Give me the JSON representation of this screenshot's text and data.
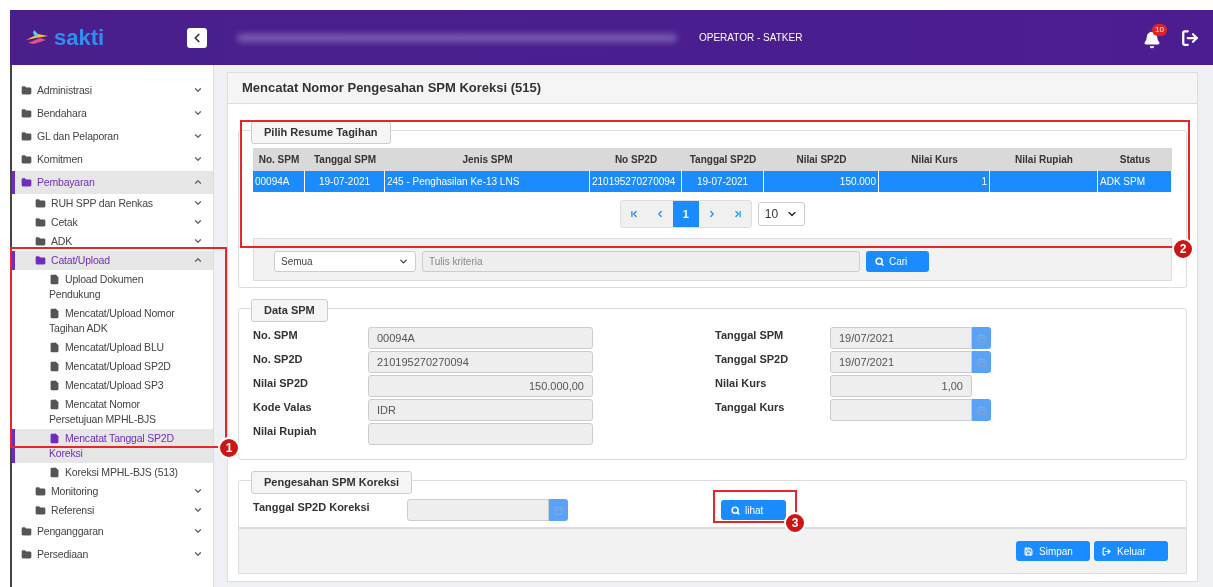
{
  "header": {
    "logo_text": "sakti",
    "role": "OPERATOR - SATKER",
    "notification_count": "10"
  },
  "sidebar": {
    "items": [
      {
        "label": "Administrasi",
        "kind": "folder",
        "expanded": false,
        "selected": false
      },
      {
        "label": "Bendahara",
        "kind": "folder",
        "expanded": false,
        "selected": false
      },
      {
        "label": "GL dan Pelaporan",
        "kind": "folder",
        "expanded": false,
        "selected": false
      },
      {
        "label": "Komitmen",
        "kind": "folder",
        "expanded": false,
        "selected": false
      },
      {
        "label": "Pembayaran",
        "kind": "folder",
        "expanded": true,
        "selected": true,
        "children": [
          {
            "label": "RUH SPP dan Renkas",
            "kind": "folder",
            "expanded": false,
            "selected": false
          },
          {
            "label": "Cetak",
            "kind": "folder",
            "expanded": false,
            "selected": false
          },
          {
            "label": "ADK",
            "kind": "folder",
            "expanded": false,
            "selected": false
          },
          {
            "label": "Catat/Upload",
            "kind": "folder",
            "expanded": true,
            "selected": true,
            "children": [
              {
                "label": "Upload Dokumen Pendukung",
                "kind": "file",
                "selected": false
              },
              {
                "label": "Mencatat/Upload Nomor Tagihan ADK",
                "kind": "file",
                "selected": false
              },
              {
                "label": "Mencatat/Upload BLU",
                "kind": "file",
                "selected": false
              },
              {
                "label": "Mencatat/Upload SP2D",
                "kind": "file",
                "selected": false
              },
              {
                "label": "Mencatat/Upload SP3",
                "kind": "file",
                "selected": false
              },
              {
                "label": "Mencatat Nomor Persetujuan MPHL-BJS",
                "kind": "file",
                "selected": false
              },
              {
                "label": "Mencatat Tanggal SP2D Koreksi",
                "kind": "file",
                "selected": true
              },
              {
                "label": "Koreksi MPHL-BJS (513)",
                "kind": "file",
                "selected": false
              }
            ]
          },
          {
            "label": "Monitoring",
            "kind": "folder",
            "expanded": false,
            "selected": false
          },
          {
            "label": "Referensi",
            "kind": "folder",
            "expanded": false,
            "selected": false
          }
        ]
      },
      {
        "label": "Penganggaran",
        "kind": "folder",
        "expanded": false,
        "selected": false
      },
      {
        "label": "Persediaan",
        "kind": "folder",
        "expanded": false,
        "selected": false
      }
    ]
  },
  "page_title": "Mencatat Nomor Pengesahan SPM Koreksi (515)",
  "resume": {
    "legend": "Pilih Resume Tagihan",
    "table": {
      "columns": [
        "No. SPM",
        "Tanggal SPM",
        "Jenis SPM",
        "No SP2D",
        "Tanggal SP2D",
        "Nilai SP2D",
        "Nilai Kurs",
        "Nilai Rupiah",
        "Status"
      ],
      "rows": [
        {
          "cells": [
            "00094A",
            "19-07-2021",
            "245 - Penghasilan Ke-13 LNS",
            "210195270270094",
            "19-07-2021",
            "150.000",
            "1",
            "",
            "ADK SPM"
          ],
          "selected": true
        }
      ]
    },
    "pagination": {
      "pages": [
        {
          "label": "1",
          "selected": true
        }
      ],
      "page_size": "10"
    },
    "filter": {
      "select": "Semua",
      "placeholder": "Tulis kriteria",
      "button": "Cari"
    }
  },
  "data_spm": {
    "legend": "Data SPM",
    "left_fields": [
      {
        "label": "No. SPM",
        "value": "00094A",
        "kind": "text"
      },
      {
        "label": "No. SP2D",
        "value": "210195270270094",
        "kind": "text"
      },
      {
        "label": "Nilai SP2D",
        "value": "150.000,00",
        "kind": "amount"
      },
      {
        "label": "Kode Valas",
        "value": "IDR",
        "kind": "text"
      },
      {
        "label": "Nilai Rupiah",
        "kind": "text"
      }
    ],
    "right_fields": [
      {
        "label": "Tanggal SPM",
        "value": "19/07/2021",
        "kind": "date"
      },
      {
        "label": "Tanggal SP2D",
        "value": "19/07/2021",
        "kind": "date"
      },
      {
        "label": "Nilai Kurs",
        "value": "1,00",
        "kind": "amount"
      },
      {
        "label": "Tanggal Kurs",
        "kind": "date"
      }
    ]
  },
  "pengesahan": {
    "legend": "Pengesahan SPM Koreksi",
    "field": {
      "label": "Tanggal SP2D Koreksi",
      "kind": "date"
    },
    "button": "lihat"
  },
  "actions": [
    {
      "label": "Simpan",
      "kind": "save"
    },
    {
      "label": "Keluar",
      "kind": "exit"
    }
  ],
  "annotations": [
    {
      "label": "1"
    },
    {
      "label": "2"
    },
    {
      "label": "3"
    }
  ]
}
